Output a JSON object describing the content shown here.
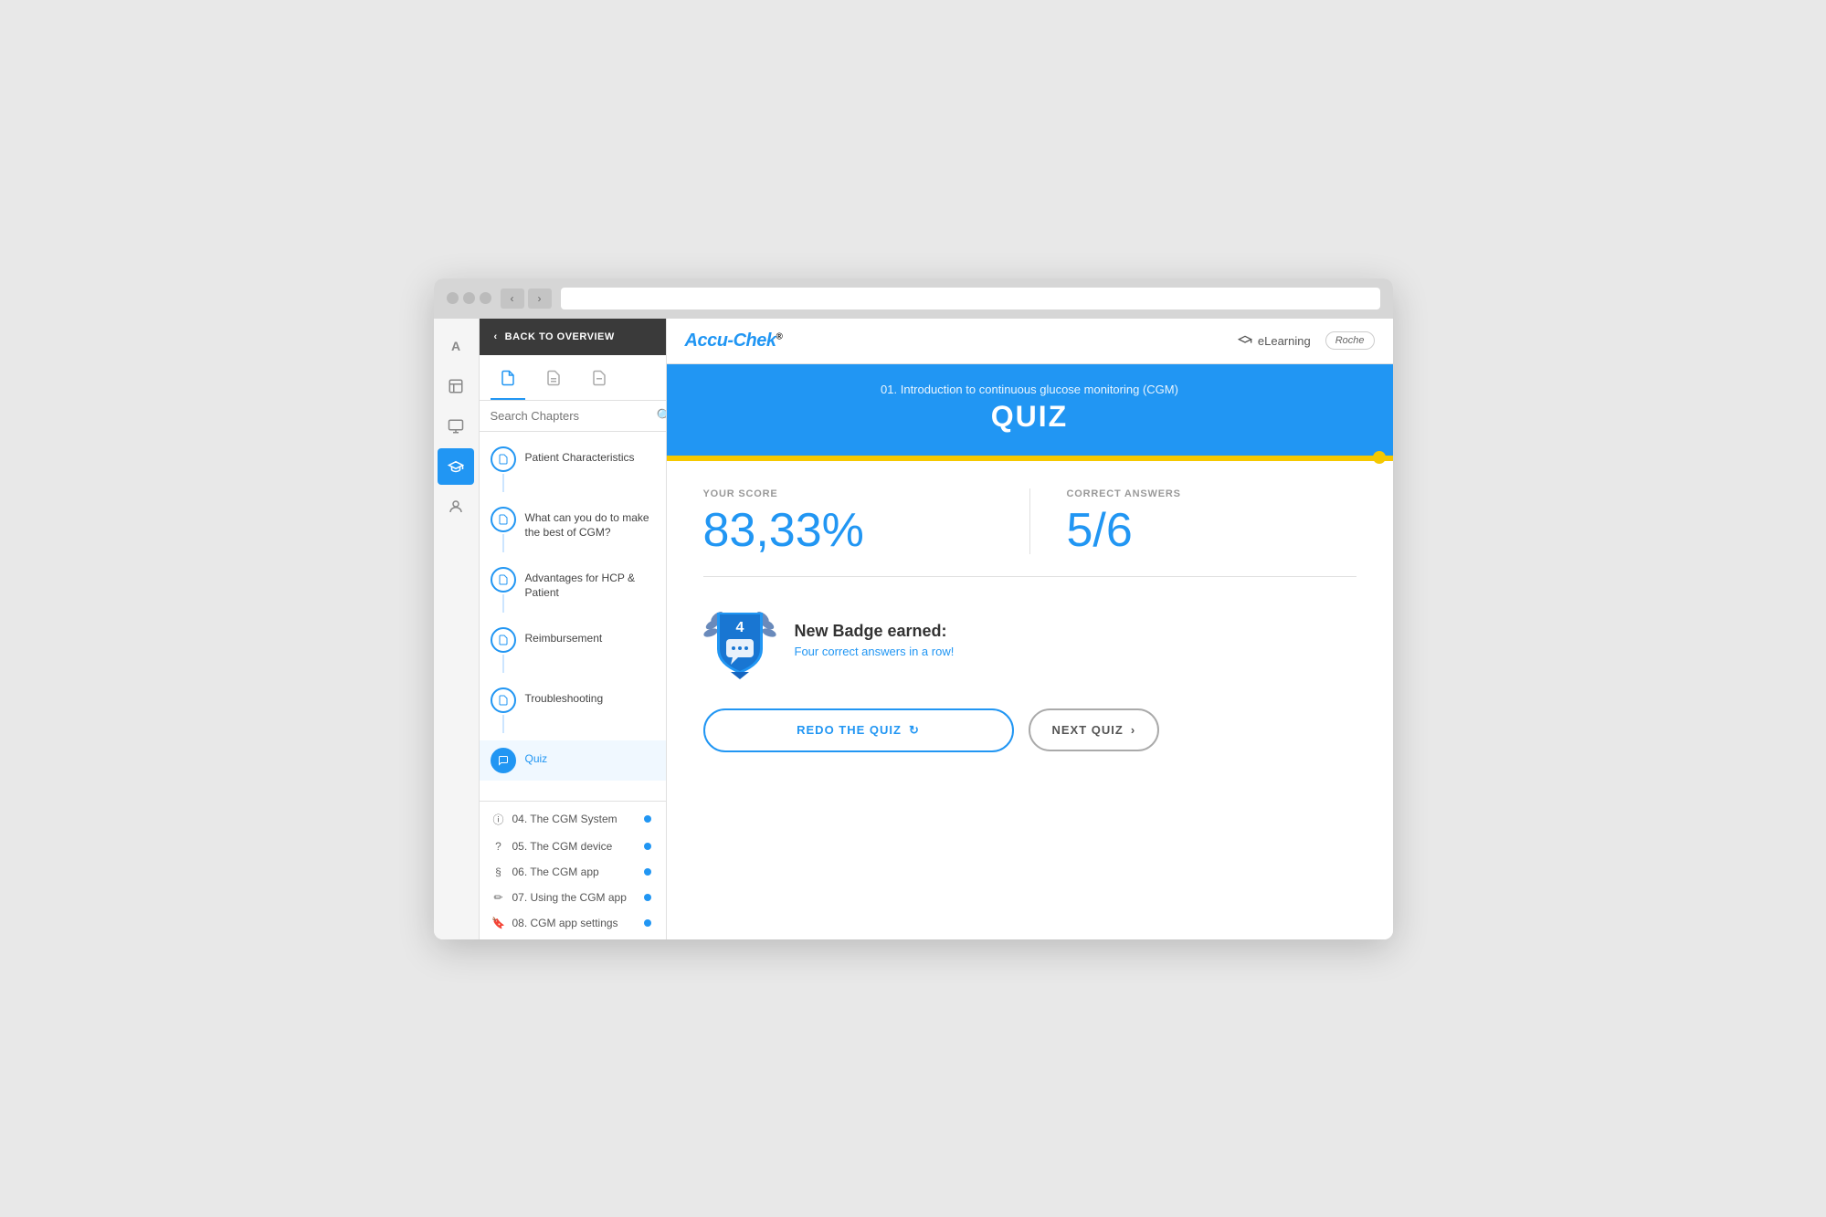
{
  "browser": {
    "url": ""
  },
  "back_btn": "BACK TO OVERVIEW",
  "brand": {
    "name_part1": "Accu-Chek",
    "name_superscript": "®",
    "elearning_label": "eLearning",
    "roche_label": "Roche"
  },
  "sidebar_tabs": [
    {
      "label": "📄",
      "active": true
    },
    {
      "label": "📋",
      "active": false
    },
    {
      "label": "🗒",
      "active": false
    }
  ],
  "search_placeholder": "Search Chapters",
  "chapters": [
    {
      "icon": "📄",
      "text": "Patient Characteristics",
      "active": false,
      "quiz": false
    },
    {
      "icon": "📄",
      "text": "What can you do to make the best of CGM?",
      "active": false,
      "quiz": false
    },
    {
      "icon": "📄",
      "text": "Advantages for HCP & Patient",
      "active": false,
      "quiz": false
    },
    {
      "icon": "📄",
      "text": "Reimbursement",
      "active": false,
      "quiz": false
    },
    {
      "icon": "📄",
      "text": "Troubleshooting",
      "active": false,
      "quiz": false
    },
    {
      "icon": "💬",
      "text": "Quiz",
      "active": true,
      "quiz": true
    }
  ],
  "modules": [
    {
      "number": "04.",
      "label": "The CGM System"
    },
    {
      "number": "05.",
      "label": "The CGM device"
    },
    {
      "number": "06.",
      "label": "The CGM app"
    },
    {
      "number": "07.",
      "label": "Using the CGM app"
    },
    {
      "number": "08.",
      "label": "CGM app settings"
    }
  ],
  "rail_icons": [
    "🎓",
    "📦",
    "🖥",
    "📚",
    "👤"
  ],
  "quiz": {
    "subtitle": "01. Introduction to continuous glucose monitoring (CGM)",
    "title": "QUIZ",
    "your_score_label": "YOUR SCORE",
    "your_score_value": "83,33%",
    "correct_answers_label": "CORRECT ANSWERS",
    "correct_answers_value": "5/6",
    "badge_number": "4",
    "badge_earned_label": "New Badge earned:",
    "badge_earned_subtitle": "Four correct answers in a row!",
    "redo_btn": "REDO THE QUIZ",
    "next_btn": "NEXT QUIZ"
  }
}
